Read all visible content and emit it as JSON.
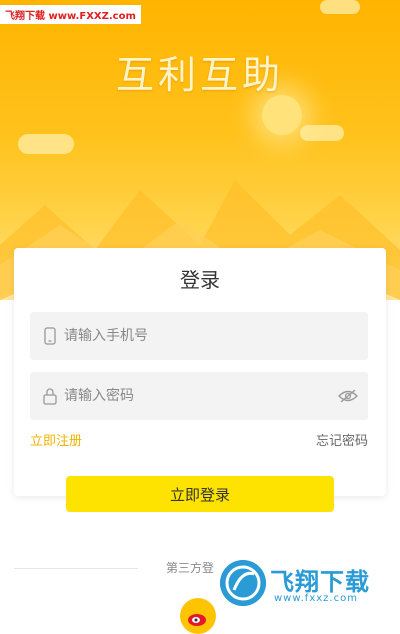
{
  "watermark_top": {
    "site": "飞翔下载",
    "url": "www.FXXZ.com"
  },
  "hero": {
    "title": "互利互助"
  },
  "login": {
    "title": "登录",
    "phone_placeholder": "请输入手机号",
    "password_placeholder": "请输入密码",
    "register_label": "立即注册",
    "forgot_label": "忘记密码",
    "submit_label": "立即登录"
  },
  "third_party": {
    "label": "第三方登"
  },
  "watermark_bottom": {
    "brand": "飞翔下载",
    "url": "www.fxxz.com"
  },
  "colors": {
    "accent": "#ffe300",
    "link": "#f0b400",
    "hero": "#ffb400",
    "watermark": "#2a9bd5"
  },
  "icons": {
    "phone": "phone-icon",
    "lock": "lock-icon",
    "eye": "eye-icon",
    "weibo": "weibo-icon"
  }
}
